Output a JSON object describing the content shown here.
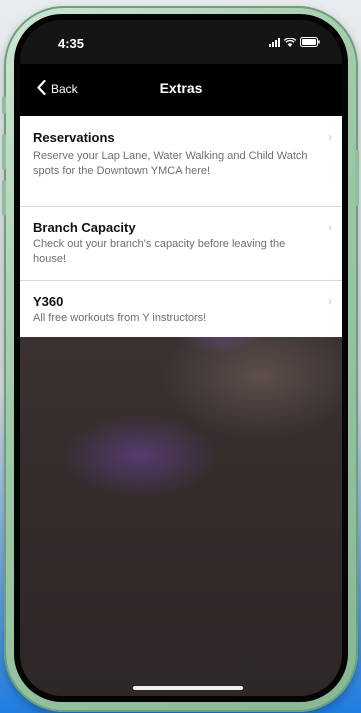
{
  "status_bar": {
    "time": "4:35"
  },
  "nav": {
    "back_label": "Back",
    "title": "Extras"
  },
  "items": [
    {
      "title": "Reservations",
      "description": "Reserve your Lap Lane, Water Walking and Child Watch spots for the Downtown YMCA here!"
    },
    {
      "title": "Branch Capacity",
      "description": "Check out your branch's capacity before leaving the house!"
    },
    {
      "title": "Y360",
      "description": "All free workouts from Y instructors!"
    }
  ]
}
